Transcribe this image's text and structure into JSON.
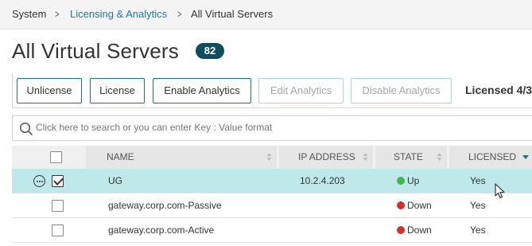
{
  "breadcrumb": {
    "items": [
      "System",
      "Licensing & Analytics",
      "All Virtual Servers"
    ],
    "separator": ">"
  },
  "page": {
    "title": "All Virtual Servers",
    "count": "82"
  },
  "toolbar": {
    "unlicense_label": "Unlicense",
    "license_label": "License",
    "enable_analytics_label": "Enable Analytics",
    "edit_analytics_label": "Edit Analytics",
    "disable_analytics_label": "Disable Analytics",
    "licensed_summary": "Licensed 4/3"
  },
  "search": {
    "placeholder": "Click here to search or you can enter Key : Value format"
  },
  "table": {
    "columns": [
      "NAME",
      "IP ADDRESS",
      "STATE",
      "LICENSED"
    ],
    "sorted_column": "LICENSED",
    "rows": [
      {
        "name": "UG",
        "ip": "10.2.4.203",
        "state": "Up",
        "licensed": "Yes",
        "selected": true
      },
      {
        "name": "gateway.corp.com-Passive",
        "ip": "",
        "state": "Down",
        "licensed": "Yes",
        "selected": false
      },
      {
        "name": "gateway.corp.com-Active",
        "ip": "",
        "state": "Down",
        "licensed": "Yes",
        "selected": false
      }
    ]
  },
  "colors": {
    "link": "#1b7aa8",
    "badge": "#0f4c5c",
    "button_border": "#1f6f86",
    "selected_row": "#bfe8ea",
    "state_up": "#3cb94a",
    "state_down": "#d0312d"
  },
  "icons": [
    "chevron-right-icon",
    "search-icon",
    "sort-icon",
    "sort-down-icon",
    "more-options-icon",
    "checkbox-icon",
    "cursor-icon"
  ]
}
